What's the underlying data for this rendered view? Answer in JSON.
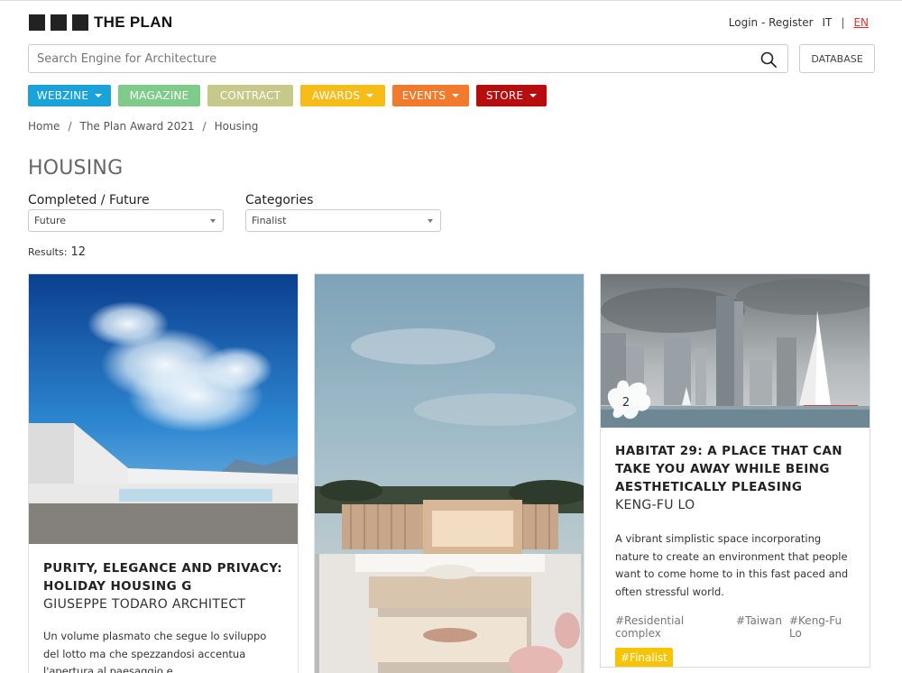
{
  "header": {
    "logo_text": "THE PLAN",
    "auth_link": "Login - Register",
    "lang_it": "IT",
    "lang_sep": "|",
    "lang_en": "EN",
    "search_placeholder": "Search Engine for Architecture",
    "database_label": "DATABASE"
  },
  "nav": {
    "items": [
      {
        "label": "WEBZINE",
        "color": "#1aa3d9",
        "dropdown": true
      },
      {
        "label": "MAGAZINE",
        "color": "#7fcb8a",
        "dropdown": false
      },
      {
        "label": "CONTRACT",
        "color": "#c6c98a",
        "dropdown": false
      },
      {
        "label": "AWARDS",
        "color": "#f6bc18",
        "dropdown": true
      },
      {
        "label": "EVENTS",
        "color": "#f27a2c",
        "dropdown": true
      },
      {
        "label": "STORE",
        "color": "#b80d0d",
        "dropdown": true
      }
    ]
  },
  "breadcrumb": {
    "home": "Home",
    "sep": "/",
    "award": "The Plan Award 2021",
    "current": "Housing"
  },
  "page": {
    "title": "HOUSING",
    "filter1_label": "Completed / Future",
    "filter1_value": "Future",
    "filter2_label": "Categories",
    "filter2_value": "Finalist",
    "results_label": "Results:",
    "results_count": "12"
  },
  "cards": [
    {
      "title": "PURITY, ELEGANCE AND PRIVACY: HOLIDAY HOUSING G",
      "author": "GIUSEPPE TODARO ARCHITECT",
      "description": "Un volume plasmato che segue lo sviluppo del lotto ma che spezzandosi accentua l'apertura al paesaggio e contemporaneamente la"
    },
    {
      "title": "",
      "author": "",
      "description": ""
    },
    {
      "title": "HABITAT 29: A PLACE THAT CAN TAKE YOU AWAY WHILE BEING AESTHETICALLY PLEASING",
      "author": "KENG-FU LO",
      "description": "A vibrant simplistic space incorporating nature to create an environment that people want to come home to in this fast paced and often stressful world.",
      "badge_number": "2",
      "tags": [
        "#Residential complex",
        "#Taiwan",
        "#Keng-Fu Lo"
      ],
      "badge": "#Finalist"
    }
  ]
}
